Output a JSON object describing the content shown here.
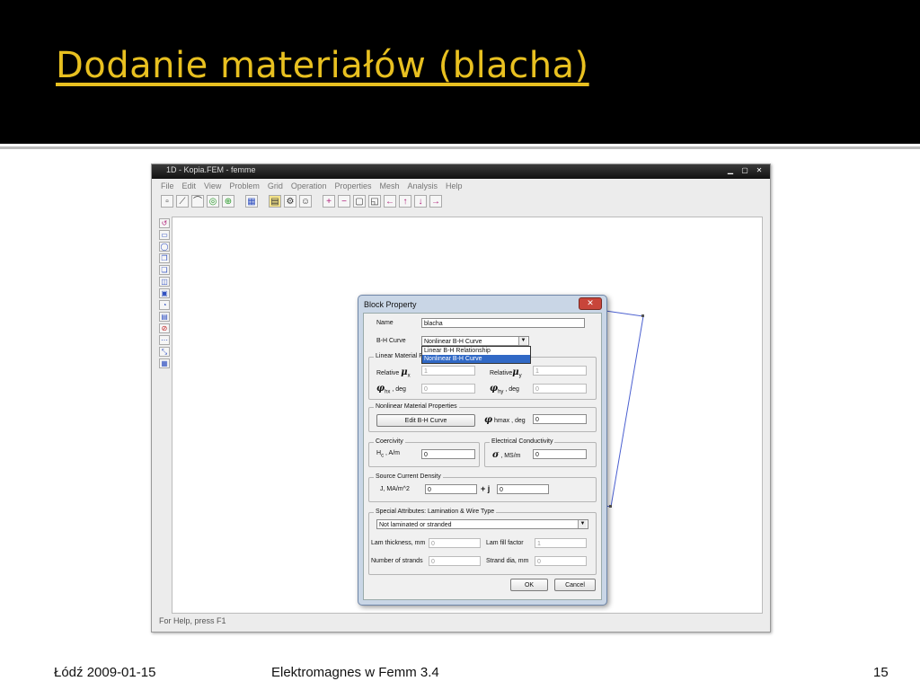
{
  "slide": {
    "title": "Dodanie materiałów (blacha)",
    "footer_left": "Łódź 2009-01-15",
    "footer_center": "Elektromagnes w Femm 3.4",
    "page_number": "15",
    "title_color": "#e8c020"
  },
  "app": {
    "title": "1D - Kopia.FEM - femme",
    "menu": [
      "File",
      "Edit",
      "View",
      "Problem",
      "Grid",
      "Operation",
      "Properties",
      "Mesh",
      "Analysis",
      "Help"
    ],
    "status": "For Help, press F1"
  },
  "dialog": {
    "title": "Block Property",
    "name_label": "Name",
    "name_value": "blacha",
    "bh_label": "B-H Curve",
    "bh_value": "Nonlinear B-H Curve",
    "bh_options": [
      "Linear B-H Relationship",
      "Nonlinear B-H Curve"
    ],
    "linear_group": "Linear Material Pr",
    "relative_label": "Relative",
    "mu_x_value": "1",
    "mu_y_value": "1",
    "phi_hx_label": ", deg",
    "phi_hx_value": "0",
    "phi_hy_label": ", deg",
    "phi_hy_value": "0",
    "nonlinear_group": "Nonlinear Material Properties",
    "edit_bh_button": "Edit B-H Curve",
    "phi_hmax_label": "hmax , deg",
    "phi_hmax_value": "0",
    "coercivity_group": "Coercivity",
    "hc_label": ", A/m",
    "hc_value": "0",
    "conductivity_group": "Electrical Conductivity",
    "sigma_label": ", MS/m",
    "sigma_value": "0",
    "source_group": "Source Current Density",
    "j_label": "J, MA/m^2",
    "j_real": "0",
    "j_imag_prefix": "+ j",
    "j_imag": "0",
    "special_group": "Special Attributes:  Lamination & Wire Type",
    "lamination_value": "Not laminated or stranded",
    "lam_thickness_label": "Lam thickness, mm",
    "lam_thickness_value": "0",
    "lam_fill_label": "Lam fill factor",
    "lam_fill_value": "1",
    "strands_label": "Number of strands",
    "strands_value": "0",
    "strand_dia_label": "Strand dia, mm",
    "strand_dia_value": "0",
    "ok_button": "OK",
    "cancel_button": "Cancel"
  }
}
